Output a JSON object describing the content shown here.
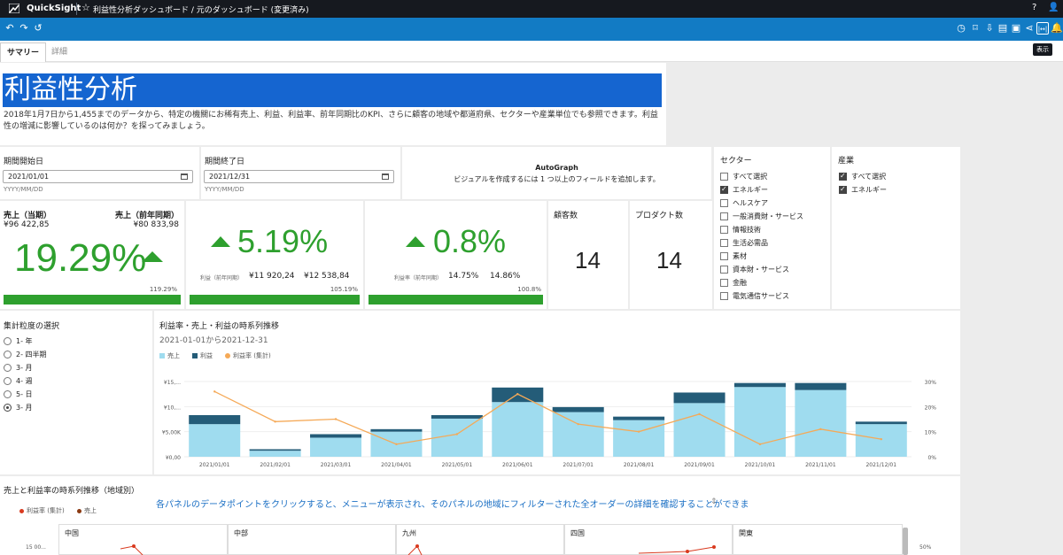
{
  "topbar": {
    "app": "QuickSight",
    "breadcrumb": "利益性分析ダッシュボード / 元のダッシュボード (変更済み)"
  },
  "tooltip": "表示",
  "tabs": [
    "サマリー",
    "詳細"
  ],
  "title": "利益性分析",
  "description": "2018年1月7日から1,455までのデータから、特定の機關にお稀有売上、利益、利益率、前年同期比のKPI、さらに顧客の地域や都道府県、セクターや産業単位でも参照できます。利益性の増減に影響しているのは何か？を探ってみましょう。",
  "start_date": {
    "label": "期間開始日",
    "value": "2021/01/01",
    "hint": "YYYY/MM/DD"
  },
  "end_date": {
    "label": "期間終了日",
    "value": "2021/12/31",
    "hint": "YYYY/MM/DD"
  },
  "autograph": {
    "title": "AutoGraph",
    "message": "ビジュアルを作成するには 1 つ以上のフィールドを追加します。"
  },
  "sector": {
    "title": "セクター",
    "items": [
      {
        "label": "すべて選択",
        "checked": false
      },
      {
        "label": "エネルギー",
        "checked": true
      },
      {
        "label": "ヘルスケア",
        "checked": false
      },
      {
        "label": "一般消費財・サービス",
        "checked": false
      },
      {
        "label": "情報技術",
        "checked": false
      },
      {
        "label": "生活必需品",
        "checked": false
      },
      {
        "label": "素材",
        "checked": false
      },
      {
        "label": "資本財・サービス",
        "checked": false
      },
      {
        "label": "金融",
        "checked": false
      },
      {
        "label": "電気通信サービス",
        "checked": false
      }
    ]
  },
  "industry": {
    "title": "産業",
    "items": [
      {
        "label": "すべて選択",
        "checked": true
      },
      {
        "label": "エネルギー",
        "checked": true
      }
    ]
  },
  "kpi1": {
    "label_current": "売上（当期）",
    "label_prev": "売上（前年同期）",
    "current": "¥96 422,85",
    "prev": "¥80 833,98",
    "value": "19.29%",
    "bar_label": "119.29%",
    "progress": 1.1929
  },
  "kpi2": {
    "value": "5.19%",
    "sub_label": "利益（前年同期）",
    "prev": "¥11 920,24",
    "current": "¥12 538,84",
    "bar_label": "105.19%",
    "progress": 1.0519
  },
  "kpi3": {
    "value": "0.8%",
    "sub_label": "利益率（前年同期）",
    "prev": "14.75%",
    "current": "14.86%",
    "bar_label": "100.8%",
    "progress": 1.008
  },
  "customers": {
    "label": "顧客数",
    "value": "14"
  },
  "products": {
    "label": "プロダクト数",
    "value": "14"
  },
  "granularity": {
    "title": "集計粒度の選択",
    "options": [
      {
        "label": "1- 年",
        "checked": false
      },
      {
        "label": "2- 四半期",
        "checked": false
      },
      {
        "label": "3- 月",
        "checked": false
      },
      {
        "label": "4- 週",
        "checked": false
      },
      {
        "label": "5- 日",
        "checked": false
      },
      {
        "label": "3- 月",
        "checked": true
      }
    ]
  },
  "chart_title": "利益率・売上・利益の時系列推移",
  "chart_subtitle": "2021-01-01から2021-12-31",
  "chart_data": {
    "type": "bar",
    "categories": [
      "2021/01/01",
      "2021/02/01",
      "2021/03/01",
      "2021/04/01",
      "2021/05/01",
      "2021/06/01",
      "2021/07/01",
      "2021/08/01",
      "2021/09/01",
      "2021/10/01",
      "2021/11/01",
      "2021/12/01"
    ],
    "series": [
      {
        "name": "売上",
        "type": "bar",
        "color": "#9fdcef",
        "values": [
          6500,
          1200,
          3800,
          5000,
          7600,
          10900,
          8900,
          7300,
          10700,
          13900,
          13300,
          6500
        ]
      },
      {
        "name": "利益",
        "type": "bar",
        "color": "#245c78",
        "values": [
          1800,
          300,
          700,
          500,
          700,
          2900,
          1000,
          700,
          2100,
          800,
          1400,
          500
        ]
      },
      {
        "name": "利益率 (集計)",
        "type": "line",
        "axis": "right",
        "color": "#f5a957",
        "values": [
          26,
          14,
          15,
          5,
          9,
          25,
          13,
          10,
          17,
          5,
          11,
          7
        ]
      }
    ],
    "left_ticks": [
      "¥0,00",
      "¥5,00K",
      "¥10,...",
      "¥15,..."
    ],
    "right_ticks": [
      "0%",
      "10%",
      "20%",
      "30%"
    ],
    "ylim": [
      0,
      15000
    ],
    "y2lim": [
      0,
      30
    ]
  },
  "bottom": {
    "title": "売上と利益率の時系列推移（地域別）",
    "note": "各パネルのデータポイントをクリックすると、メニューが表示され、そのパネルの地域にフィルターされた全オーダーの詳細を確認することができま",
    "legend": [
      "利益率 (集計)",
      "売上"
    ],
    "legend_colors": [
      "#d93a1f",
      "#8b3a12"
    ],
    "tick": "15 00...",
    "right_tick": "50%",
    "panels": [
      "中国",
      "中部",
      "九州",
      "四国",
      "関東"
    ]
  }
}
